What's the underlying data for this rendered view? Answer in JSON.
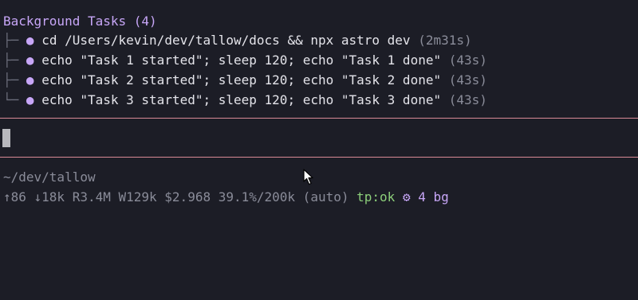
{
  "panel": {
    "title": "Background Tasks (4)",
    "tasks": [
      {
        "branch": "├─",
        "command": "cd /Users/kevin/dev/tallow/docs && npx astro dev",
        "duration": "(2m31s)"
      },
      {
        "branch": "├─",
        "command": "echo \"Task 1 started\"; sleep 120; echo \"Task 1 done\"",
        "duration": "(43s)"
      },
      {
        "branch": "├─",
        "command": "echo \"Task 2 started\"; sleep 120; echo \"Task 2 done\"",
        "duration": "(43s)"
      },
      {
        "branch": "└─",
        "command": "echo \"Task 3 started\"; sleep 120; echo \"Task 3 done\"",
        "duration": "(43s)"
      }
    ],
    "dot_glyph": "●"
  },
  "input": {
    "value": ""
  },
  "status": {
    "cwd": "~/dev/tallow",
    "stats": "↑86 ↓18k R3.4M W129k $2.968 39.1%/200k (auto)",
    "tp": "tp:ok",
    "gear_glyph": "⚙",
    "bg": "4 bg"
  },
  "colors": {
    "background": "#1c1d26",
    "accent_purple": "#c7a6f7",
    "muted": "#8a8c99",
    "ok_green": "#8ccf7a",
    "rule_pink": "#d98a96"
  },
  "icons": [
    "bullet-dot-icon",
    "gear-icon",
    "mouse-pointer-icon"
  ]
}
